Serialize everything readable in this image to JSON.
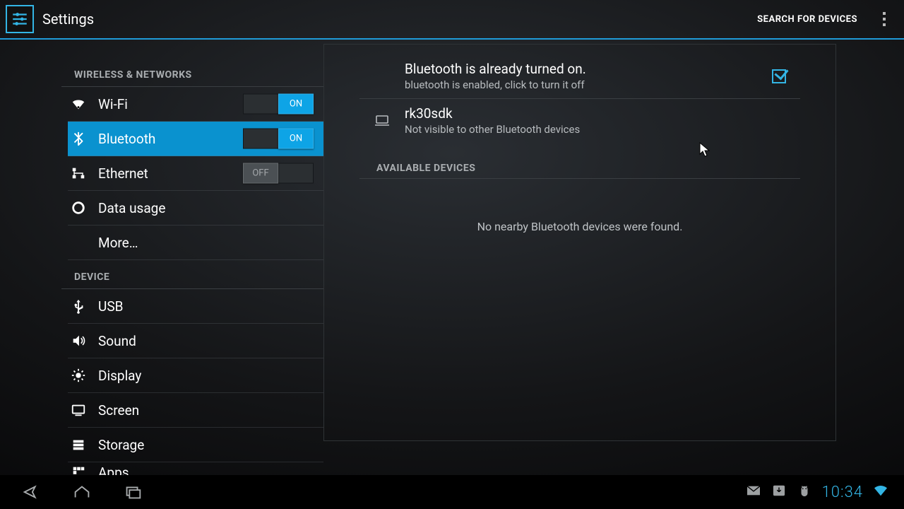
{
  "header": {
    "title": "Settings",
    "search_label": "SEARCH FOR DEVICES"
  },
  "toggle": {
    "on": "ON",
    "off": "OFF"
  },
  "sidebar": {
    "section_wireless": "WIRELESS & NETWORKS",
    "section_device": "DEVICE",
    "items": {
      "wifi": "Wi-Fi",
      "bluetooth": "Bluetooth",
      "ethernet": "Ethernet",
      "data_usage": "Data usage",
      "more": "More…",
      "usb": "USB",
      "sound": "Sound",
      "display": "Display",
      "screen": "Screen",
      "storage": "Storage",
      "apps": "Apps"
    }
  },
  "detail": {
    "bt_on_title": "Bluetooth is already turned on.",
    "bt_on_sub": "bluetooth is enabled, click to turn it off",
    "device_name": "rk30sdk",
    "device_sub": "Not visible to other Bluetooth devices",
    "available_header": "AVAILABLE DEVICES",
    "empty": "No nearby Bluetooth devices were found."
  },
  "statusbar": {
    "time": "10:34"
  }
}
